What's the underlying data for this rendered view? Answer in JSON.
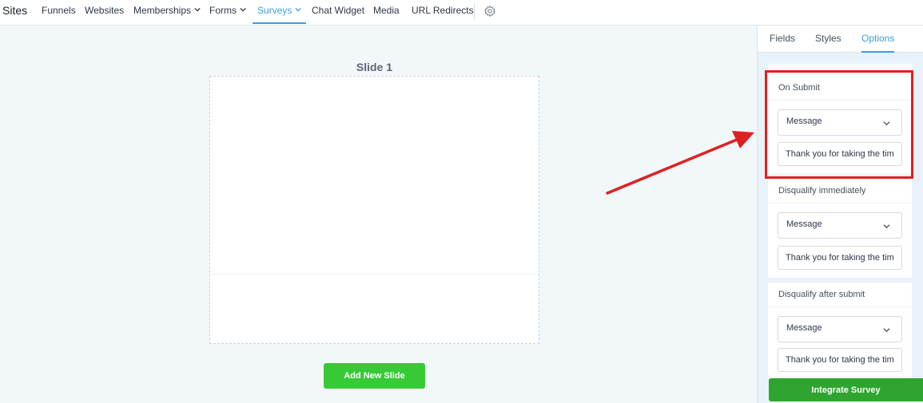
{
  "nav": {
    "brand": "Sites",
    "items": [
      "Funnels",
      "Websites",
      "Memberships",
      "Forms",
      "Surveys",
      "Chat Widget",
      "Media",
      "URL Redirects"
    ],
    "active": "Surveys",
    "settings_icon": "gear-icon"
  },
  "canvas": {
    "slide_title": "Slide 1",
    "add_slide_label": "Add New Slide"
  },
  "panel": {
    "tabs": [
      "Fields",
      "Styles",
      "Options"
    ],
    "active_tab": "Options",
    "sections": [
      {
        "label": "On Submit",
        "select_value": "Message",
        "text_value": "Thank you for taking the time"
      },
      {
        "label": "Disqualify immediately",
        "select_value": "Message",
        "text_value": "Thank you for taking the time"
      },
      {
        "label": "Disqualify after submit",
        "select_value": "Message",
        "text_value": "Thank you for taking the time"
      }
    ],
    "integrate_label": "Integrate Survey"
  },
  "colors": {
    "accent": "#3b9fd8",
    "add_button": "#37ca37",
    "integrate_button": "#2fa52f",
    "annotation": "#e02020"
  }
}
